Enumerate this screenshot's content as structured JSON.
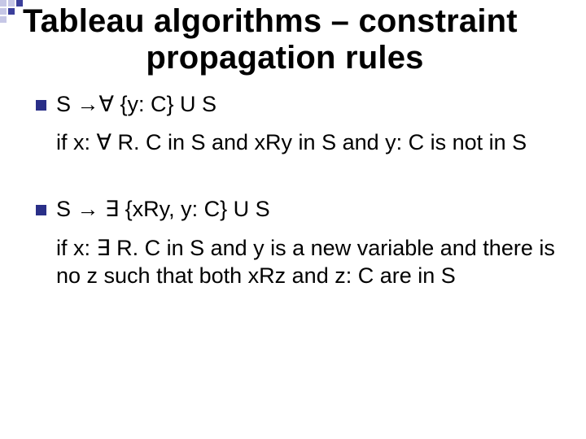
{
  "title": {
    "line1": "Tableau algorithms – constraint",
    "line2": "propagation rules"
  },
  "rules": {
    "forall": {
      "head": "S →∀ {y: C} U S",
      "condition": "if x: ∀ R. C in S and xRy in S and y: C is not in S"
    },
    "exists": {
      "head": "S → ∃ {xRy, y: C} U S",
      "condition": "if x: ∃ R. C in S and y is a new variable and there is no z such that both xRz and z: C are in S"
    }
  }
}
